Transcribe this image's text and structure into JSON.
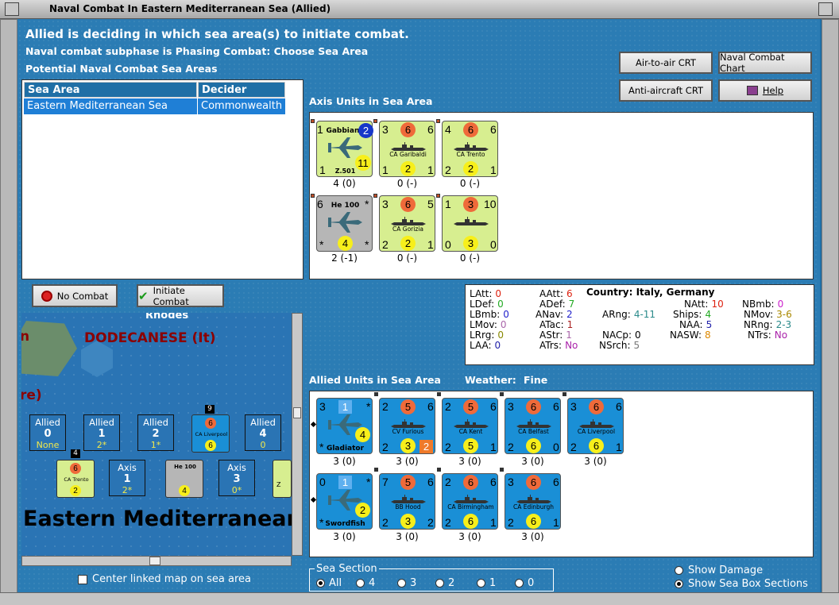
{
  "window": {
    "title": "Naval Combat In Eastern Mediterranean Sea (Allied)"
  },
  "header": {
    "line1": "Allied is deciding in which sea area(s) to initiate combat.",
    "line2": "Naval combat subphase is Phasing Combat: Choose Sea Area",
    "line3": "Potential Naval Combat Sea Areas"
  },
  "buttons": {
    "air_to_air": "Air-to-air CRT",
    "naval_chart": "Naval Combat Chart",
    "anti_aircraft": "Anti-aircraft CRT",
    "help": "Help",
    "no_combat": "No Combat",
    "initiate_combat": "Initiate Combat"
  },
  "sea_table": {
    "columns": [
      "Sea Area",
      "Decider"
    ],
    "rows": [
      [
        "Eastern Mediterranean Sea",
        "Commonwealth"
      ]
    ]
  },
  "axis_label": "Axis Units in Sea Area",
  "allied_label": "Allied Units in Sea Area",
  "weather": {
    "label": "Weather:",
    "value": "Fine"
  },
  "axis_units": [
    {
      "kind": "plane",
      "bg": "axis",
      "tl": "1",
      "title": "Gabbiano",
      "tr": "2",
      "bl": "1",
      "name": "Z.501",
      "br": "",
      "big": "11",
      "cap": "4 (0)"
    },
    {
      "kind": "ship",
      "bg": "axis",
      "tl": "3",
      "mid": "6",
      "tr": "6",
      "name": "CA Garibaldi",
      "bl": "1",
      "bm": "2",
      "br": "1",
      "cap": "0 (-)"
    },
    {
      "kind": "ship",
      "bg": "axis",
      "tl": "4",
      "mid": "6",
      "tr": "6",
      "name": "CA Trento",
      "bl": "2",
      "bm": "2",
      "br": "1",
      "cap": "0 (-)"
    },
    {
      "kind": "plane",
      "bg": "grey",
      "tl": "6",
      "title": "He 100",
      "tr": "*",
      "bl": "*",
      "bm": "4",
      "br": "*",
      "cap": "2 (-1)"
    },
    {
      "kind": "ship",
      "bg": "axis",
      "tl": "3",
      "mid": "6",
      "tr": "5",
      "name": "CA Gorizia",
      "bl": "2",
      "bm": "2",
      "br": "1",
      "cap": "0 (-)"
    },
    {
      "kind": "carrier",
      "bg": "axis",
      "tl": "1",
      "mid": "3",
      "tr": "10",
      "name": "",
      "bl": "0",
      "bm": "3",
      "br": "0",
      "cap": "0 (-)"
    }
  ],
  "allied_units": [
    {
      "kind": "plane",
      "tl": "3",
      "sq": "1",
      "tr": "*",
      "name": "Gladiator",
      "bl": "*",
      "br": "4",
      "cap": "3 (0)"
    },
    {
      "kind": "ship",
      "tl": "2",
      "mid": "5",
      "tr": "6",
      "name": "CV Furious",
      "bl": "2",
      "bm": "3",
      "br": "2",
      "cap": "3 (0)"
    },
    {
      "kind": "ship",
      "tl": "2",
      "mid": "5",
      "tr": "6",
      "name": "CA Kent",
      "bl": "2",
      "bm": "5",
      "br": "1",
      "cap": "3 (0)"
    },
    {
      "kind": "ship",
      "tl": "3",
      "mid": "6",
      "tr": "6",
      "name": "CA Belfast",
      "bl": "2",
      "bm": "6",
      "br": "0",
      "cap": "3 (0)"
    },
    {
      "kind": "ship",
      "tl": "3",
      "mid": "6",
      "tr": "6",
      "name": "CA Liverpool",
      "bl": "2",
      "bm": "6",
      "br": "1",
      "cap": "3 (0)"
    },
    {
      "kind": "plane",
      "tl": "0",
      "sq": "1",
      "tr": "*",
      "name": "Swordfish",
      "bl": "*",
      "br": "2",
      "cap": "3 (0)"
    },
    {
      "kind": "ship",
      "tl": "7",
      "mid": "5",
      "tr": "6",
      "name": "BB Hood",
      "bl": "2",
      "bm": "3",
      "br": "2",
      "cap": "3 (0)"
    },
    {
      "kind": "ship",
      "tl": "2",
      "mid": "6",
      "tr": "6",
      "name": "CA Birmingham",
      "bl": "2",
      "bm": "6",
      "br": "1",
      "cap": "3 (0)"
    },
    {
      "kind": "ship",
      "tl": "3",
      "mid": "6",
      "tr": "6",
      "name": "CA Edinburgh",
      "bl": "2",
      "bm": "6",
      "br": "1",
      "cap": "3 (0)"
    }
  ],
  "stats": {
    "country": "Country: Italy, Germany",
    "items": [
      {
        "k": "LAtt:",
        "v": "0",
        "c": "#d21"
      },
      {
        "k": "LDef:",
        "v": "0",
        "c": "#2a2"
      },
      {
        "k": "LBmb:",
        "v": "0",
        "c": "#22c"
      },
      {
        "k": "LMov:",
        "v": "0",
        "c": "#a6a"
      },
      {
        "k": "LRrg:",
        "v": "0",
        "c": "#880"
      },
      {
        "k": "LAA:",
        "v": "0",
        "c": "#22a"
      },
      {
        "k": "AAtt:",
        "v": "6",
        "c": "#d21"
      },
      {
        "k": "ADef:",
        "v": "7",
        "c": "#2a2"
      },
      {
        "k": "ANav:",
        "v": "2",
        "c": "#22c"
      },
      {
        "k": "ATac:",
        "v": "1",
        "c": "#a22"
      },
      {
        "k": "AStr:",
        "v": "1",
        "c": "#a6a"
      },
      {
        "k": "ATrs:",
        "v": "No",
        "c": "#a2a"
      },
      {
        "k": "ARng:",
        "v": "4-11",
        "c": "#2a8a8a"
      },
      {
        "k": "NACp:",
        "v": "0",
        "c": "#000"
      },
      {
        "k": "NSrch:",
        "v": "5",
        "c": "#777"
      },
      {
        "k": "NAtt:",
        "v": "10",
        "c": "#d21"
      },
      {
        "k": "Ships:",
        "v": "4",
        "c": "#2a2"
      },
      {
        "k": "NAA:",
        "v": "5",
        "c": "#22a"
      },
      {
        "k": "NASW:",
        "v": "8",
        "c": "#d80"
      },
      {
        "k": "NBmb:",
        "v": "0",
        "c": "#c2c"
      },
      {
        "k": "NMov:",
        "v": "3-6",
        "c": "#a80"
      },
      {
        "k": "NRng:",
        "v": "2-3",
        "c": "#2a8a8a"
      },
      {
        "k": "NTrs:",
        "v": "No",
        "c": "#a2a"
      }
    ]
  },
  "map": {
    "rhodes": "Rhodes",
    "dodecanese": "DODECANESE (It)",
    "edge_re": "re)",
    "edge_n": "n",
    "sea_name": "Eastern Mediterranean",
    "boxes": [
      {
        "side": "Allied",
        "n": "0",
        "v": "None"
      },
      {
        "side": "Allied",
        "n": "1",
        "v": "2*"
      },
      {
        "side": "Allied",
        "n": "2",
        "v": "1*"
      },
      {
        "side": "Allied",
        "n": "4",
        "v": "0"
      },
      {
        "side": "Axis",
        "n": "1",
        "v": "2*"
      },
      {
        "side": "Axis",
        "n": "3",
        "v": "0*"
      }
    ],
    "stack_9": "9",
    "stack_4": "4",
    "mini_liverpool": "CA Liverpool",
    "mini_trento": "CA Trento",
    "mini_he100": "He 100",
    "mini_z": "Z"
  },
  "center_linked": "Center linked map on sea area",
  "sea_section": {
    "label": "Sea Section",
    "options": [
      "All",
      "4",
      "3",
      "2",
      "1",
      "0"
    ],
    "selected": "All"
  },
  "show_damage": "Show Damage",
  "show_sea_box": "Show Sea Box Sections",
  "colors": {
    "axis": "#d7ee90",
    "allied": "#1a8fd6",
    "sea_blue": "#2b7cb4"
  }
}
